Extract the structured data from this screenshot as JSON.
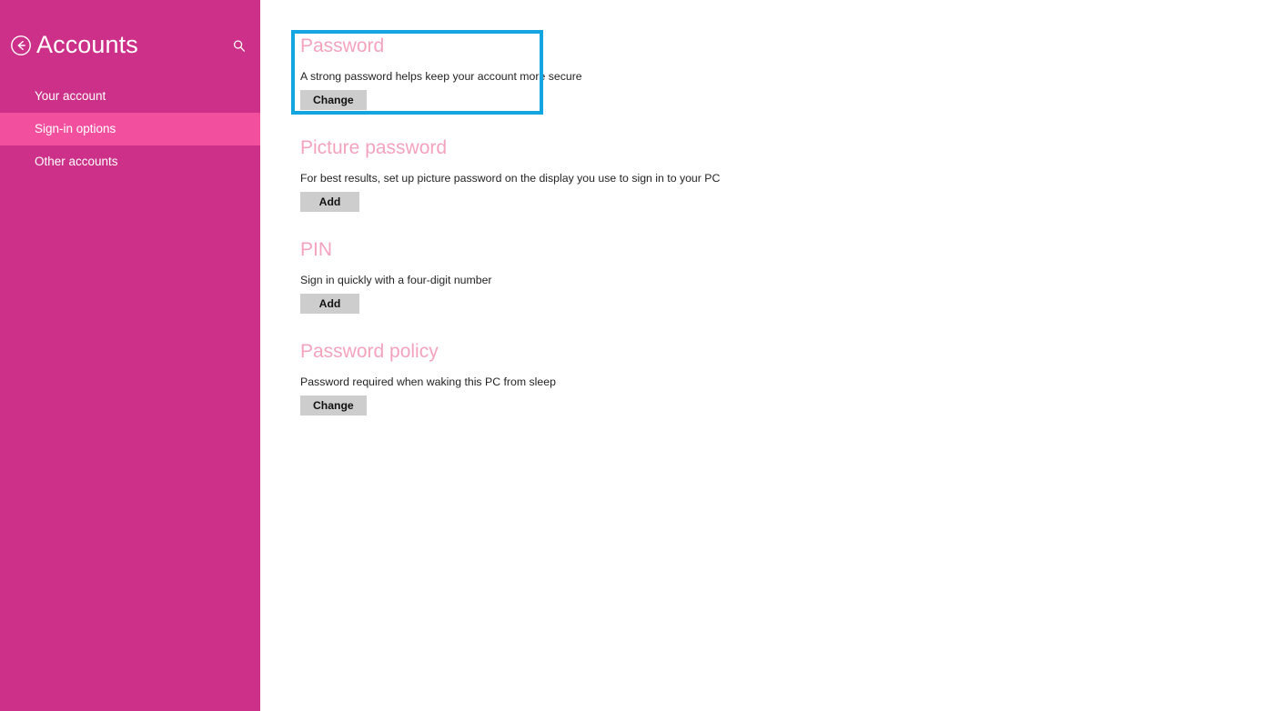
{
  "sidebar": {
    "back_icon": "back-arrow-circle-icon",
    "title": "Accounts",
    "search_icon": "search-icon",
    "items": [
      {
        "label": "Your account",
        "selected": false
      },
      {
        "label": "Sign-in options",
        "selected": true
      },
      {
        "label": "Other accounts",
        "selected": false
      }
    ],
    "colors": {
      "background": "#cc3088",
      "selected_background": "#f2509f",
      "text": "#ffffff"
    }
  },
  "main": {
    "sections": [
      {
        "heading": "Password",
        "description": "A strong password helps keep your account more secure",
        "button_label": "Change"
      },
      {
        "heading": "Picture password",
        "description": "For best results, set up picture password on the display you use to sign in to your PC",
        "button_label": "Add"
      },
      {
        "heading": "PIN",
        "description": "Sign in quickly with a four-digit number",
        "button_label": "Add"
      },
      {
        "heading": "Password policy",
        "description": "Password required when waking this PC from sleep",
        "button_label": "Change"
      }
    ],
    "colors": {
      "heading": "#f4a3bd",
      "description": "#232323",
      "button_background": "#cdcdcd",
      "button_text": "#111111",
      "background": "#ffffff"
    }
  },
  "annotation": {
    "highlight_target": "Password",
    "border_color": "#12a5e0"
  }
}
